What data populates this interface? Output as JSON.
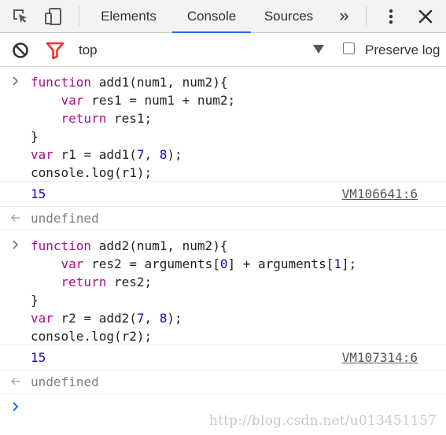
{
  "tabs": {
    "items": [
      {
        "label": "Elements"
      },
      {
        "label": "Console",
        "active": true
      },
      {
        "label": "Sources"
      }
    ],
    "more_symbol": "»"
  },
  "toolbar": {
    "context": "top",
    "preserve_log_label": "Preserve log"
  },
  "colors": {
    "keyword": "#aa0d91",
    "number": "#1c00cf",
    "filter_icon": "#ff2d2d",
    "active_tab_underline": "#1a73e8"
  },
  "console": {
    "blocks": [
      {
        "input_lines": [
          [
            {
              "t": "kw",
              "v": "function"
            },
            {
              "t": "plain",
              "v": " add1(num1, num2){"
            }
          ],
          [
            {
              "t": "plain",
              "v": "    "
            },
            {
              "t": "kw",
              "v": "var"
            },
            {
              "t": "plain",
              "v": " res1 = num1 + num2;"
            }
          ],
          [
            {
              "t": "plain",
              "v": "    "
            },
            {
              "t": "kw",
              "v": "return"
            },
            {
              "t": "plain",
              "v": " res1;"
            }
          ],
          [
            {
              "t": "plain",
              "v": "}"
            }
          ],
          [
            {
              "t": "kw",
              "v": "var"
            },
            {
              "t": "plain",
              "v": " r1 = add1("
            },
            {
              "t": "num",
              "v": "7"
            },
            {
              "t": "plain",
              "v": ", "
            },
            {
              "t": "num",
              "v": "8"
            },
            {
              "t": "plain",
              "v": ");"
            }
          ],
          [
            {
              "t": "plain",
              "v": "console.log(r1);"
            }
          ]
        ],
        "log_value": "15",
        "log_source": "VM106641:6",
        "result": "undefined"
      },
      {
        "input_lines": [
          [
            {
              "t": "kw",
              "v": "function"
            },
            {
              "t": "plain",
              "v": " add2(num1, num2){"
            }
          ],
          [
            {
              "t": "plain",
              "v": "    "
            },
            {
              "t": "kw",
              "v": "var"
            },
            {
              "t": "plain",
              "v": " res2 = arguments["
            },
            {
              "t": "num",
              "v": "0"
            },
            {
              "t": "plain",
              "v": "] + arguments["
            },
            {
              "t": "num",
              "v": "1"
            },
            {
              "t": "plain",
              "v": "];"
            }
          ],
          [
            {
              "t": "plain",
              "v": "    "
            },
            {
              "t": "kw",
              "v": "return"
            },
            {
              "t": "plain",
              "v": " res2;"
            }
          ],
          [
            {
              "t": "plain",
              "v": "}"
            }
          ],
          [
            {
              "t": "kw",
              "v": "var"
            },
            {
              "t": "plain",
              "v": " r2 = add2("
            },
            {
              "t": "num",
              "v": "7"
            },
            {
              "t": "plain",
              "v": ", "
            },
            {
              "t": "num",
              "v": "8"
            },
            {
              "t": "plain",
              "v": ");"
            }
          ],
          [
            {
              "t": "plain",
              "v": "console.log(r2);"
            }
          ]
        ],
        "log_value": "15",
        "log_source": "VM107314:6",
        "result": "undefined"
      }
    ]
  },
  "watermark": "http://blog.csdn.net/u013451157"
}
